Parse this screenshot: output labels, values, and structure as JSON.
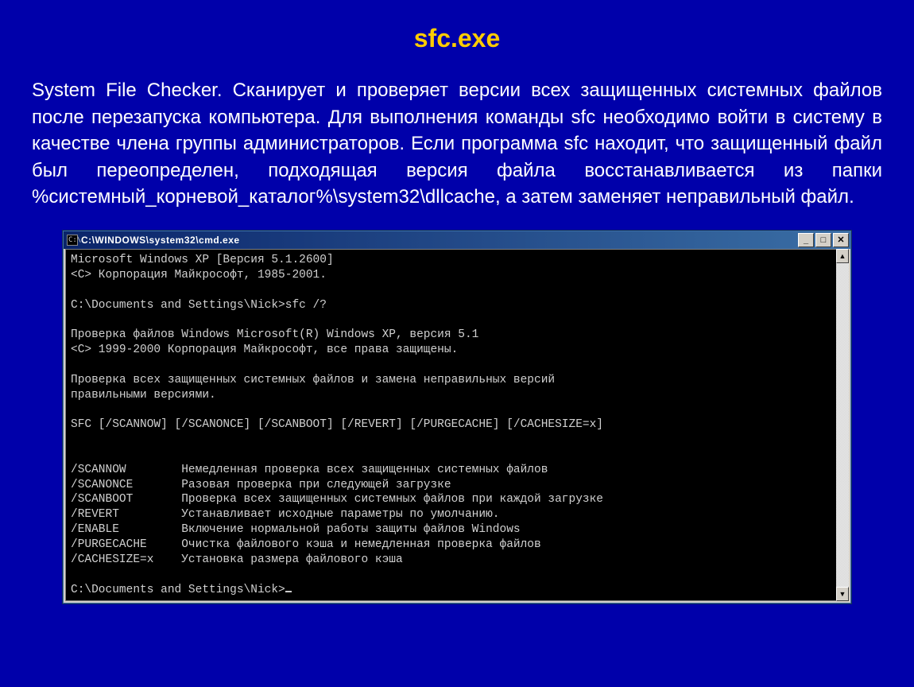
{
  "title": "sfc.exe",
  "description": "System File Checker. Сканирует и проверяет версии всех защищенных системных файлов после перезапуска компьютера. Для выполнения команды sfc необходимо войти в систему в качестве члена группы администраторов. Если программа sfc находит, что защищенный файл был переопределен, подходящая версия файла восстанавливается из папки %системный_корневой_каталог%\\system32\\dllcache, а затем заменяет неправильный файл.",
  "cmd": {
    "icon_text": "C:\\",
    "window_title": "C:\\WINDOWS\\system32\\cmd.exe",
    "buttons": {
      "minimize": "_",
      "maximize": "□",
      "close": "✕"
    },
    "scroll": {
      "up": "▲",
      "down": "▼"
    },
    "lines": [
      "Microsoft Windows XP [Версия 5.1.2600]",
      "<C> Корпорация Майкрософт, 1985-2001.",
      "",
      "C:\\Documents and Settings\\Nick>sfc /?",
      "",
      "Проверка файлов Windows Microsoft(R) Windows XP, версия 5.1",
      "<C> 1999-2000 Корпорация Майкрософт, все права защищены.",
      "",
      "Проверка всех защищенных системных файлов и замена неправильных версий",
      "правильными версиями.",
      "",
      "SFC [/SCANNOW] [/SCANONCE] [/SCANBOOT] [/REVERT] [/PURGECACHE] [/CACHESIZE=x]",
      "",
      "",
      "/SCANNOW        Немедленная проверка всех защищенных системных файлов",
      "/SCANONCE       Разовая проверка при следующей загрузке",
      "/SCANBOOT       Проверка всех защищенных системных файлов при каждой загрузке",
      "/REVERT         Устанавливает исходные параметры по умолчанию.",
      "/ENABLE         Включение нормальной работы защиты файлов Windows",
      "/PURGECACHE     Очистка файлового кэша и немедленная проверка файлов",
      "/CACHESIZE=x    Установка размера файлового кэша",
      "",
      "C:\\Documents and Settings\\Nick>"
    ]
  }
}
